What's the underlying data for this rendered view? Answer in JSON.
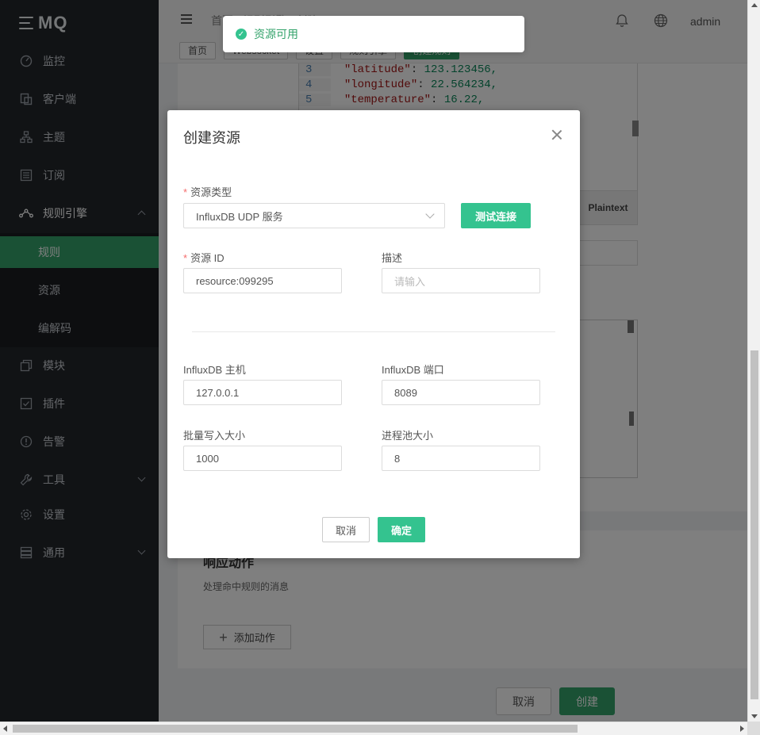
{
  "app": {
    "logo": "MQ"
  },
  "sidebar": {
    "items": [
      {
        "label": "监控",
        "icon": "dashboard-icon"
      },
      {
        "label": "客户端",
        "icon": "clients-icon"
      },
      {
        "label": "主题",
        "icon": "topics-icon"
      },
      {
        "label": "订阅",
        "icon": "subscriptions-icon"
      },
      {
        "label": "规则引擎",
        "icon": "rule-engine-icon"
      },
      {
        "label": "模块",
        "icon": "modules-icon"
      },
      {
        "label": "插件",
        "icon": "plugins-icon"
      },
      {
        "label": "告警",
        "icon": "alarm-icon"
      },
      {
        "label": "工具",
        "icon": "tools-icon"
      },
      {
        "label": "设置",
        "icon": "settings-icon"
      },
      {
        "label": "通用",
        "icon": "general-icon"
      }
    ],
    "subitems": [
      {
        "label": "规则",
        "active": true
      },
      {
        "label": "资源",
        "active": false
      },
      {
        "label": "编解码",
        "active": false
      }
    ]
  },
  "header": {
    "breadcrumb": "首页  /  规则引擎  /  创建",
    "user": "admin",
    "tags": [
      "首页",
      "Websocket",
      "设置",
      "规则引擎",
      "创建规则"
    ]
  },
  "editor": {
    "lines": [
      {
        "n": "3",
        "key": "\"latitude\"",
        "val": "123.123456,"
      },
      {
        "n": "4",
        "key": "\"longitude\"",
        "val": "22.564234,"
      },
      {
        "n": "5",
        "key": "\"temperature\"",
        "val": "16.22,"
      }
    ],
    "plaintext": "Plaintext"
  },
  "response": {
    "title": "响应动作",
    "desc": "处理命中规则的消息",
    "add_action": "添加动作"
  },
  "footer": {
    "cancel": "取消",
    "create": "创建"
  },
  "toast": {
    "message": "资源可用"
  },
  "dialog": {
    "title": "创建资源",
    "resource_type_label": "资源类型",
    "resource_type_value": "InfluxDB UDP 服务",
    "test_button": "测试连接",
    "resource_id_label": "资源 ID",
    "resource_id_value": "resource:099295",
    "desc_label": "描述",
    "desc_placeholder": "请输入",
    "host_label": "InfluxDB 主机",
    "host_value": "127.0.0.1",
    "port_label": "InfluxDB 端口",
    "port_value": "8089",
    "batch_label": "批量写入大小",
    "batch_value": "1000",
    "pool_label": "进程池大小",
    "pool_value": "8",
    "cancel": "取消",
    "ok": "确定"
  },
  "colors": {
    "accent": "#34c38f",
    "sidebar": "#22262b",
    "active": "#34a36b"
  }
}
